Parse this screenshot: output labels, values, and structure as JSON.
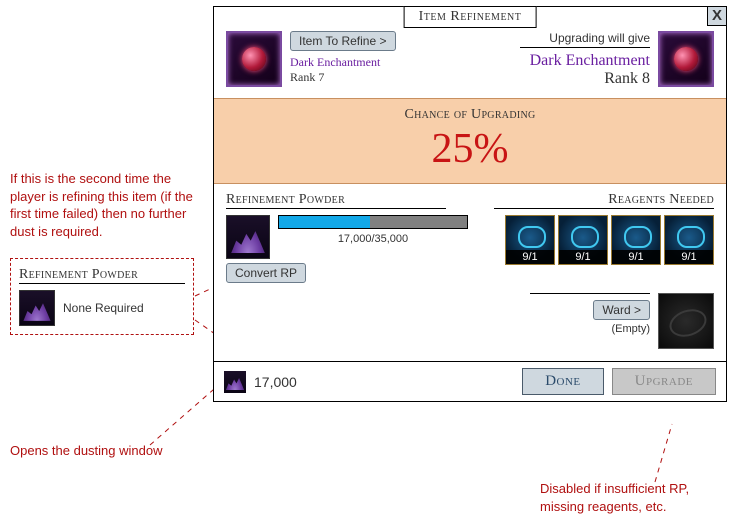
{
  "window": {
    "title": "Item Refinement",
    "close": "X"
  },
  "current_item": {
    "button": "Item To Refine >",
    "name": "Dark Enchantment",
    "rank": "Rank 7"
  },
  "upgrade_preview": {
    "label": "Upgrading will give",
    "name": "Dark Enchantment",
    "rank": "Rank 8"
  },
  "chance": {
    "label": "Chance of Upgrading",
    "value": "25%"
  },
  "powder": {
    "title": "Refinement Powder",
    "progress_text": "17,000/35,000",
    "convert_button": "Convert RP"
  },
  "reagents": {
    "title": "Reagents Needed",
    "counts": [
      "9/1",
      "9/1",
      "9/1",
      "9/1"
    ]
  },
  "ward": {
    "button": "Ward >",
    "empty": "(Empty)"
  },
  "footer": {
    "amount": "17,000",
    "done": "Done",
    "upgrade": "Upgrade"
  },
  "annotations": {
    "second_time": "If this is the second time the player is refining this item (if the first time failed) then no further dust is required.",
    "none_required_title": "Refinement Powder",
    "none_required_text": "None Required",
    "dusting": "Opens the dusting window",
    "disabled": "Disabled if insufficient RP, missing reagents, etc."
  }
}
